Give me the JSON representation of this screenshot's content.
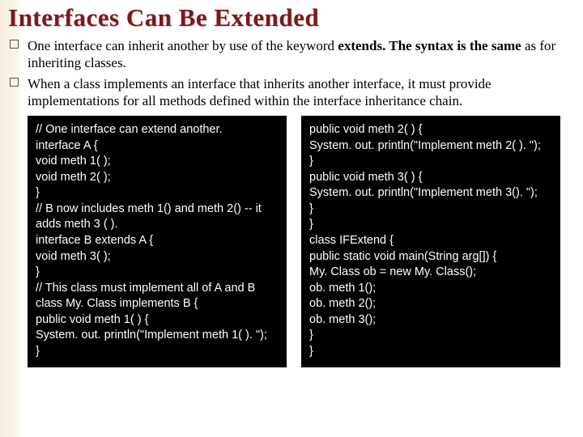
{
  "title": "Interfaces Can Be Extended",
  "bullets": [
    {
      "pre": "One interface can inherit another by use of the keyword ",
      "kw": "extends. The syntax is the same",
      "post": " as for inheriting classes."
    },
    {
      "pre": "When a class implements an interface that inherits another interface, it must provide implementations for all methods defined within the interface inheritance chain.",
      "kw": "",
      "post": ""
    }
  ],
  "code_left": "// One interface can extend another.\ninterface A {\nvoid meth 1( );\nvoid meth 2( );\n}\n// B now includes meth 1() and meth 2() -- it adds meth 3 ( ).\ninterface B extends A {\nvoid meth 3( );\n}\n// This class must implement all of A and B\nclass My. Class implements B {\npublic void meth 1( ) {\nSystem. out. println(\"Implement meth 1( ). \");\n}",
  "code_right": "public void meth 2( ) {\nSystem. out. println(\"Implement meth 2( ). \");\n}\npublic void meth 3( ) {\nSystem. out. println(\"Implement meth 3(). \");\n}\n}\nclass IFExtend {\npublic static void main(String arg[]) {\nMy. Class ob = new My. Class();\nob. meth 1();\nob. meth 2();\nob. meth 3();\n}\n}"
}
